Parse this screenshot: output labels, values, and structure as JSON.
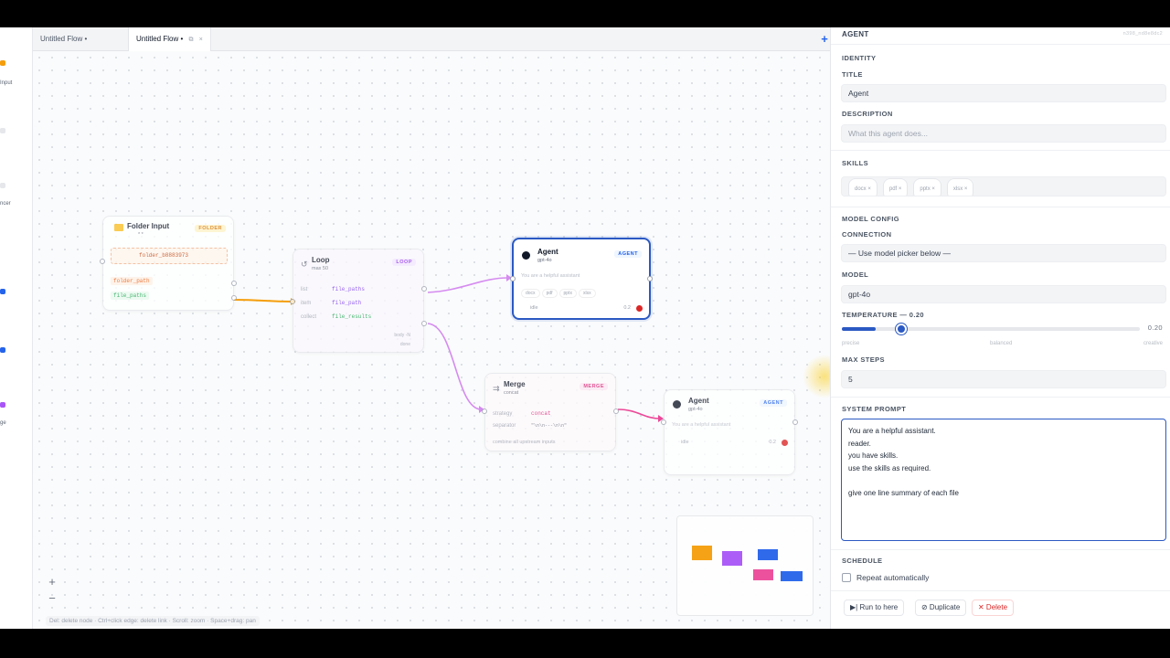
{
  "left_sidebar": {
    "items": [
      "Input",
      "ncer",
      "ge"
    ]
  },
  "tabs": [
    {
      "label": "Untitled Flow",
      "dirty": "•"
    },
    {
      "label": "Untitled Flow",
      "dirty": "•"
    }
  ],
  "add_tab": "+",
  "nodes": {
    "folder_input": {
      "title": "Folder Input",
      "subtitle": "* *",
      "badge": "FOLDER",
      "folder_chip": "folder_b8883973",
      "outputs": [
        "folder_path",
        "file_paths"
      ]
    },
    "loop": {
      "title": "Loop",
      "subtitle": "max 50",
      "badge": "LOOP",
      "rows": [
        {
          "key": "list",
          "value": "file_paths"
        },
        {
          "key": "item",
          "value": "file_path"
        },
        {
          "key": "collect",
          "value": "file_results"
        }
      ],
      "outputs": [
        "body ◦N",
        "done"
      ]
    },
    "agent_top": {
      "title": "Agent",
      "subtitle": "gpt-4o",
      "badge": "AGENT",
      "prompt_preview": "You are a helpful assistant",
      "skills": [
        "docx",
        "pdf",
        "pptx",
        "xlsx"
      ],
      "status": "idle",
      "temp": "0.2"
    },
    "merge": {
      "title": "Merge",
      "subtitle": "concat",
      "badge": "MERGE",
      "rows": [
        {
          "key": "strategy",
          "value": "concat"
        },
        {
          "key": "separator",
          "value": "\"\\n\\n---\\n\\n\""
        }
      ],
      "footer": "combine all upstream inputs"
    },
    "agent_bottom": {
      "title": "Agent",
      "subtitle": "gpt-4o",
      "badge": "AGENT",
      "prompt_preview": "You are a helpful assistant",
      "status": "idle",
      "temp": "0.2"
    }
  },
  "canvas": {
    "zoom_in": "+",
    "zoom_out": "−",
    "hint": "Del: delete node · Ctrl+click edge: delete link · Scroll: zoom · Space+drag: pan"
  },
  "minimap": {
    "colors": [
      "#f59e0b",
      "#a855f7",
      "#2563eb",
      "#ec4899",
      "#2563eb"
    ]
  },
  "panel": {
    "header": "AGENT",
    "node_id": "n398_nd8e8dc2",
    "identity": {
      "section": "IDENTITY",
      "title_label": "TITLE",
      "title_value": "Agent",
      "description_label": "DESCRIPTION",
      "description_placeholder": "What this agent does..."
    },
    "skills": {
      "label": "SKILLS",
      "items": [
        "docx",
        "pdf",
        "pptx",
        "xlsx"
      ]
    },
    "model_config": {
      "section": "MODEL CONFIG",
      "connection_label": "CONNECTION",
      "connection_value": "— Use model picker below —",
      "model_label": "MODEL",
      "model_value": "gpt-4o",
      "temperature_label": "TEMPERATURE — 0.20",
      "temperature_value": 0.2,
      "temperature_display": "0.20",
      "ticks": [
        "precise",
        "balanced",
        "creative"
      ],
      "max_steps_label": "MAX STEPS",
      "max_steps_value": "5"
    },
    "system_prompt": {
      "label": "SYSTEM PROMPT",
      "value": "You are a helpful assistant.\nreader.\nyou have skills.\nuse the skills as required.\n\ngive one line summary of each file"
    },
    "schedule": {
      "label": "SCHEDULE",
      "repeat_label": "Repeat automatically",
      "repeat_checked": false
    },
    "actions": {
      "run": "▶| Run to here",
      "duplicate": "⊘ Duplicate",
      "delete": "✕ Delete"
    }
  },
  "colors": {
    "accent": "#2b59c3",
    "folder": "#f59e0b",
    "loop": "#a855f7",
    "merge": "#ec4899",
    "agent": "#2563eb",
    "danger": "#dc2626"
  }
}
